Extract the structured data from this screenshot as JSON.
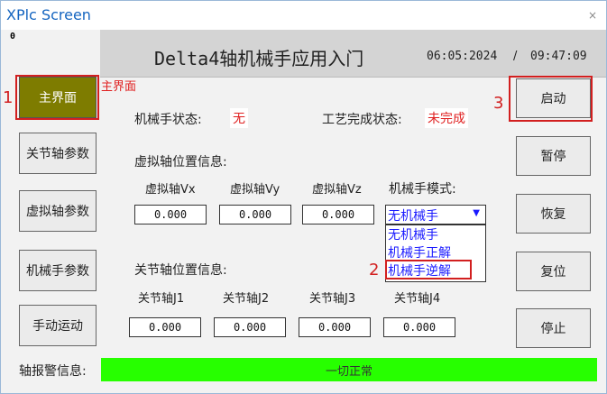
{
  "window": {
    "title": "XPlc Screen",
    "close": "×",
    "corner_label": "0"
  },
  "header": {
    "title": "Delta4轴机械手应用入门",
    "date": "06:05:2024",
    "separator": "/",
    "time": "09:47:09"
  },
  "nav": {
    "main": "主界面",
    "main_caption": "主界面",
    "joint_params": "关节轴参数",
    "virtual_params": "虚拟轴参数",
    "robot_params": "机械手参数",
    "manual": "手动运动"
  },
  "annotations": {
    "n1": "1",
    "n2": "2",
    "n3": "3"
  },
  "status": {
    "robot_state_label": "机械手状态:",
    "robot_state_value": "无",
    "process_label": "工艺完成状态:",
    "process_value": "未完成"
  },
  "virtual_axis": {
    "section_label": "虚拟轴位置信息:",
    "vx_label": "虚拟轴Vx",
    "vx_value": "0.000",
    "vy_label": "虚拟轴Vy",
    "vy_value": "0.000",
    "vz_label": "虚拟轴Vz",
    "vz_value": "0.000"
  },
  "mode": {
    "label": "机械手模式:",
    "selected": "无机械手",
    "options": [
      "无机械手",
      "机械手正解",
      "机械手逆解"
    ]
  },
  "joint_axis": {
    "section_label": "关节轴位置信息:",
    "j1_label": "关节轴J1",
    "j1_value": "0.000",
    "j2_label": "关节轴J2",
    "j2_value": "0.000",
    "j3_label": "关节轴J3",
    "j3_value": "0.000",
    "j4_label": "关节轴J4",
    "j4_value": "0.000"
  },
  "buttons": {
    "start": "启动",
    "pause": "暂停",
    "resume": "恢复",
    "reset": "复位",
    "stop": "停止"
  },
  "alarm": {
    "label": "轴报警信息:",
    "message": "一切正常"
  },
  "colors": {
    "active_nav": "#7e7c00",
    "alarm_bar": "#27ff00",
    "highlight": "#d21f1f",
    "title": "#1565c0",
    "option": "#1a1aff"
  }
}
